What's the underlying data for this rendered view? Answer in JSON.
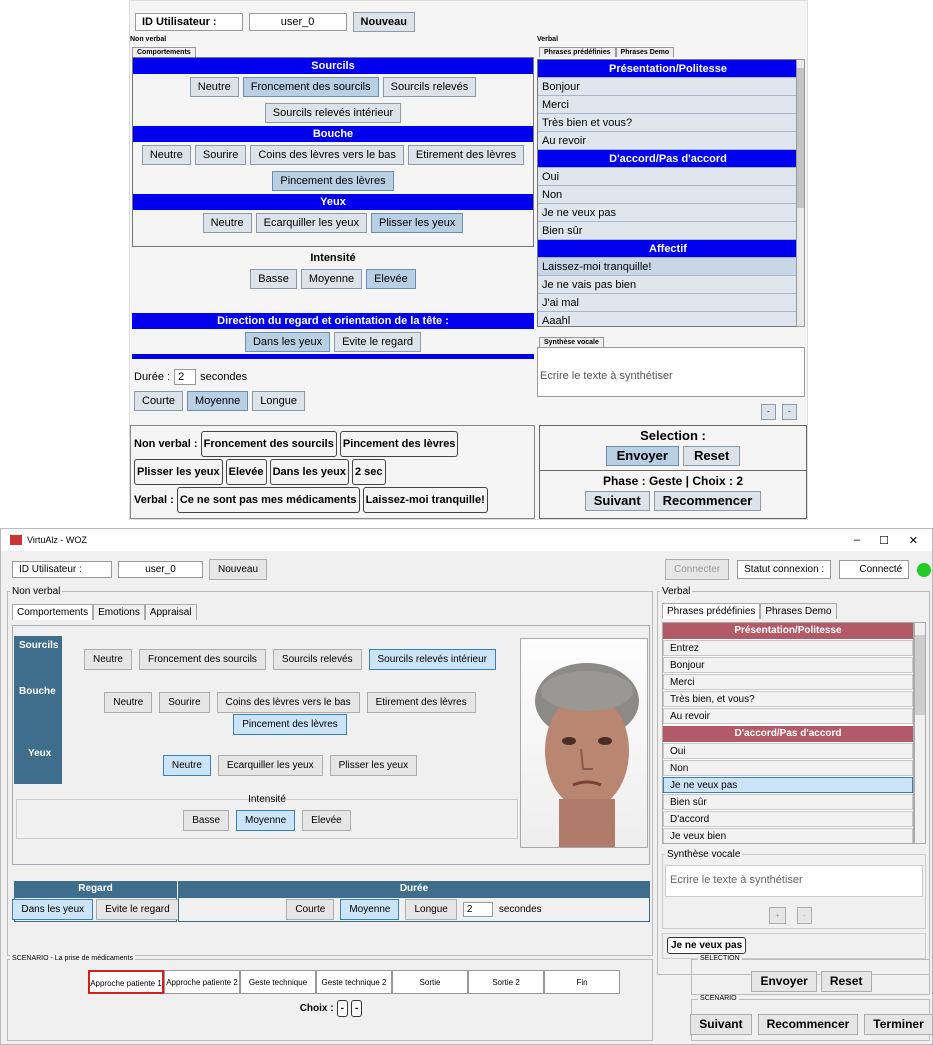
{
  "top": {
    "user_label": "ID Utilisateur :",
    "user_value": "user_0",
    "new_btn": "Nouveau",
    "nonverbal_label": "Non verbal",
    "tab_comportements": "Comportements",
    "verbal_label": "Verbal",
    "tab_phrases": "Phrases prédéfinies",
    "tab_demo": "Phrases Demo",
    "sourcils": {
      "title": "Sourcils",
      "buttons": [
        "Neutre",
        "Froncement des sourcils",
        "Sourcils relevés",
        "Sourcils relevés intérieur"
      ]
    },
    "bouche": {
      "title": "Bouche",
      "buttons": [
        "Neutre",
        "Sourire",
        "Coins des lèvres vers le bas",
        "Etirement des lèvres",
        "Pincement des lèvres"
      ]
    },
    "yeux": {
      "title": "Yeux",
      "buttons": [
        "Neutre",
        "Ecarquiller les yeux",
        "Plisser les yeux"
      ]
    },
    "intensite": {
      "title": "Intensité",
      "buttons": [
        "Basse",
        "Moyenne",
        "Elevée"
      ]
    },
    "regard": {
      "title": "Direction du regard et orientation de la tête :",
      "buttons": [
        "Dans les yeux",
        "Evite le regard"
      ]
    },
    "duree": {
      "label": "Durée :",
      "value": "2",
      "unit": "secondes",
      "buttons": [
        "Courte",
        "Moyenne",
        "Longue"
      ]
    },
    "phrases": {
      "sec1": "Présentation/Politesse",
      "items1": [
        "Bonjour",
        "Merci",
        "Très bien et vous?",
        "Au revoir"
      ],
      "sec2": "D'accord/Pas d'accord",
      "items2": [
        "Oui",
        "Non",
        "Je ne veux pas",
        "Bien sûr"
      ],
      "sec3": "Affectif",
      "items3": [
        "Laissez-moi tranquille!",
        "Je ne vais pas bien",
        "J'ai mal",
        "Aaahl"
      ]
    },
    "synth_tab": "Synthèse vocale",
    "synth_placeholder": "Ecrire le texte à synthétiser",
    "synth_btn1": "-",
    "synth_btn2": "-",
    "summary": {
      "nonverbal_label": "Non verbal :",
      "nv_chips": [
        "Froncement des sourcils",
        "Pincement des lèvres",
        "Plisser les yeux",
        "Elevée",
        "Dans les yeux",
        "2 sec"
      ],
      "verbal_label": "Verbal :",
      "v_chips": [
        "Ce ne sont pas mes médicaments",
        "Laissez-moi tranquille!"
      ]
    },
    "selection": {
      "title": "Selection :",
      "send": "Envoyer",
      "reset": "Reset",
      "phase": "Phase : Geste | Choix : 2",
      "next": "Suivant",
      "restart": "Recommencer"
    }
  },
  "bottom": {
    "title": "VirtuAlz - WOZ",
    "win_min": "–",
    "win_max": "☐",
    "win_close": "✕",
    "user_label": "ID Utilisateur :",
    "user_value": "user_0",
    "new_btn": "Nouveau",
    "connect_btn": "Connecter",
    "status_label": "Statut connexion :",
    "status_value": "Connecté",
    "status_color": "#22cc22",
    "nonverbal_label": "Non verbal",
    "tabs": [
      "Comportements",
      "Emotions",
      "Appraisal"
    ],
    "sourcils": {
      "title": "Sourcils",
      "buttons": [
        "Neutre",
        "Froncement des sourcils",
        "Sourcils relevés",
        "Sourcils relevés intérieur"
      ]
    },
    "bouche": {
      "title": "Bouche",
      "buttons": [
        "Neutre",
        "Sourire",
        "Coins des lèvres vers le bas",
        "Etirement des lèvres",
        "Pincement des lèvres"
      ]
    },
    "yeux": {
      "title": "Yeux",
      "buttons": [
        "Neutre",
        "Ecarquiller les yeux",
        "Plisser les yeux"
      ]
    },
    "intensite": {
      "title": "Intensité",
      "buttons": [
        "Basse",
        "Moyenne",
        "Elevée"
      ]
    },
    "regard": {
      "title": "Regard",
      "buttons": [
        "Dans les yeux",
        "Evite le regard"
      ]
    },
    "duree": {
      "title": "Durée",
      "buttons": [
        "Courte",
        "Moyenne",
        "Longue"
      ],
      "value": "2",
      "unit": "secondes"
    },
    "verbal_label": "Verbal",
    "vtabs": [
      "Phrases prédéfinies",
      "Phrases Demo"
    ],
    "phrases": {
      "sec1": "Présentation/Politesse",
      "items1": [
        "Entrez",
        "Bonjour",
        "Merci",
        "Très bien, et vous?",
        "Au revoir"
      ],
      "sec2": "D'accord/Pas d'accord",
      "items2": [
        "Oui",
        "Non",
        "Je ne veux pas",
        "Bien sûr",
        "D'accord",
        "Je veux bien"
      ]
    },
    "synth_label": "Synthèse vocale",
    "synth_placeholder": "Ecrire le texte à synthétiser",
    "synth_btn1": "+",
    "synth_btn2": "-",
    "verbal_chip": "Je ne veux pas",
    "scenario": {
      "title": "SCENARIO - La prise de médicaments",
      "steps": [
        "Approche patiente 1",
        "Approche patiente 2",
        "Geste technique",
        "Geste technique 2",
        "Sortie",
        "Sortie 2",
        "Fin"
      ],
      "choix_label": "Choix :",
      "choix_chips": [
        "-",
        "-"
      ]
    },
    "selection_label": "SELECTION",
    "send": "Envoyer",
    "reset": "Reset",
    "scenario_label": "SCENARIO",
    "next": "Suivant",
    "restart": "Recommencer",
    "end": "Terminer"
  }
}
